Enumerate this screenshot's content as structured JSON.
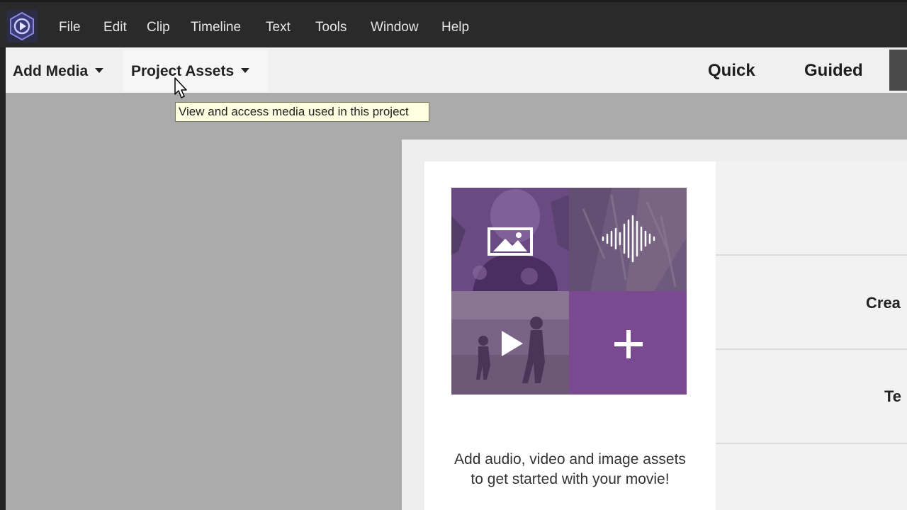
{
  "menubar": {
    "items": [
      {
        "label": "File"
      },
      {
        "label": "Edit"
      },
      {
        "label": "Clip"
      },
      {
        "label": "Timeline"
      },
      {
        "label": "Text"
      },
      {
        "label": "Tools"
      },
      {
        "label": "Window"
      },
      {
        "label": "Help"
      }
    ]
  },
  "toolbar": {
    "add_media": "Add Media",
    "project_assets": "Project Assets",
    "modes": [
      "Quick",
      "Guided"
    ]
  },
  "tooltip": {
    "text": "View and access media used in this project"
  },
  "welcome": {
    "message_line1": "Add audio, video and image assets",
    "message_line2": "to get started with your movie!",
    "tiles": [
      "image-icon",
      "audio-waveform-icon",
      "play-icon",
      "plus-icon"
    ]
  },
  "side_panel": {
    "items": [
      "Crea",
      "Te"
    ]
  },
  "colors": {
    "accent_purple": "#7a4a90",
    "menubar_bg": "#2a2a2a",
    "tooltip_bg": "#ffffe1"
  }
}
